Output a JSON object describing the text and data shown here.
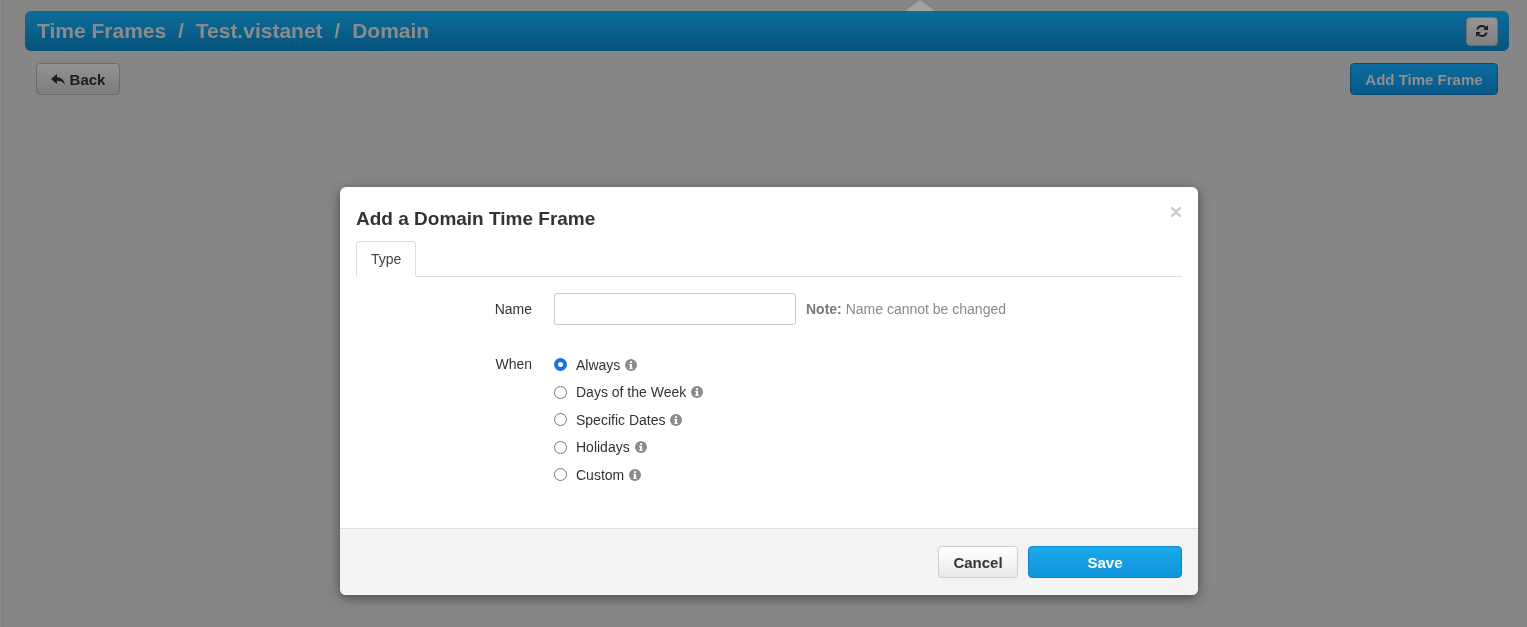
{
  "header": {
    "breadcrumb": [
      "Time Frames",
      "Test.vistanet",
      "Domain"
    ],
    "separators": [
      "/",
      "/"
    ]
  },
  "toolbar": {
    "back_button": "Back",
    "add_button": "Add Time Frame"
  },
  "dialog": {
    "title": "Add a Domain Time Frame",
    "tabs": [
      {
        "label": "Type",
        "selected": true
      }
    ],
    "fields": [
      {
        "kind": "text",
        "label": "Name",
        "note": "**Note:** Name cannot be changed"
      },
      {
        "kind": "radio",
        "label": "When",
        "options": [
          {
            "label": "Always",
            "selected": true
          },
          {
            "label": "Days of the Week",
            "selected": false
          },
          {
            "label": "Specific Dates",
            "selected": false
          },
          {
            "label": "Holidays",
            "selected": false
          },
          {
            "label": "Custom",
            "selected": false
          }
        ]
      }
    ],
    "buttons": [
      {
        "label": "Cancel",
        "kind": "default"
      },
      {
        "label": "Save",
        "kind": "primary"
      }
    ]
  }
}
